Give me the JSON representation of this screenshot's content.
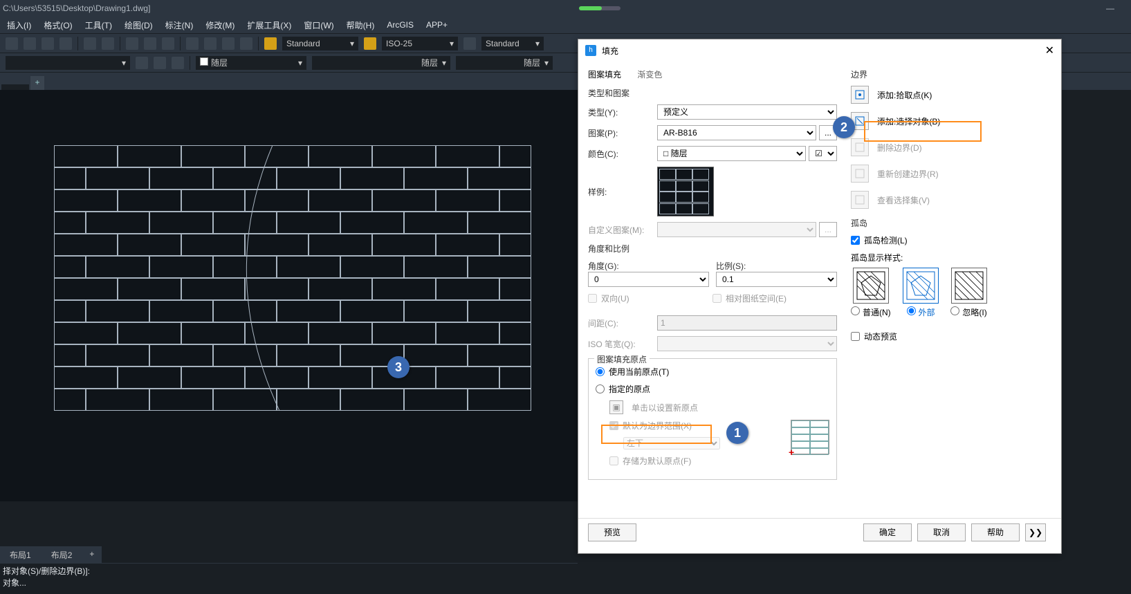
{
  "window": {
    "title": " C:\\Users\\53515\\Desktop\\Drawing1.dwg]"
  },
  "menu": {
    "insert": "插入(I)",
    "format": "格式(O)",
    "tools": "工具(T)",
    "draw": "绘图(D)",
    "dim": "标注(N)",
    "modify": "修改(M)",
    "ext": "扩展工具(X)",
    "window": "窗口(W)",
    "help": "帮助(H)",
    "arcgis": "ArcGIS",
    "app": "APP+"
  },
  "style": {
    "text": "Standard",
    "dim": "ISO-25",
    "table": "Standard"
  },
  "layer": {
    "bylayer": "随层",
    "bylayer2": "随层",
    "bylayer3": "随层"
  },
  "layouts": {
    "l1": "布局1",
    "l2": "布局2",
    "add": "+"
  },
  "cmd": {
    "line1": "择对象(S)/删除边界(B)]:",
    "line2": "对象..."
  },
  "dlg": {
    "title": "填充",
    "tab_pattern": "图案填充",
    "tab_gradient": "渐变色",
    "sec_type": "类型和图案",
    "type_lbl": "类型(Y):",
    "type_val": "预定义",
    "pattern_lbl": "图案(P):",
    "pattern_val": "AR-B816",
    "color_lbl": "颜色(C):",
    "color_val": "随层",
    "sample_lbl": "样例:",
    "custom_lbl": "自定义图案(M):",
    "sec_angle": "角度和比例",
    "angle_lbl": "角度(G):",
    "angle_val": "0",
    "scale_lbl": "比例(S):",
    "scale_val": "0.1",
    "double_lbl": "双向(U)",
    "paper_lbl": "相对图纸空间(E)",
    "spacing_lbl": "间距(C):",
    "spacing_val": "1",
    "isopen_lbl": "ISO 笔宽(Q):",
    "sec_origin": "图案填充原点",
    "origin_cur": "使用当前原点(T)",
    "origin_spec": "指定的原点",
    "origin_click": "单击以设置新原点",
    "origin_default": "默认为边界范围(X)",
    "origin_pos": "左下",
    "origin_store": "存储为默认原点(F)",
    "sec_boundary": "边界",
    "add_pick": "添加:拾取点(K)",
    "add_sel": "添加:选择对象(B)",
    "del_bound": "删除边界(D)",
    "recreate": "重新创建边界(R)",
    "view_sel": "查看选择集(V)",
    "sec_island": "孤岛",
    "island_detect": "孤岛检测(L)",
    "island_style": "孤岛显示样式:",
    "island_normal": "普通(N)",
    "island_outer": "外部",
    "island_ignore": "忽略(I)",
    "dyn_preview": "动态预览",
    "btn_preview": "预览",
    "btn_ok": "确定",
    "btn_cancel": "取消",
    "btn_help": "帮助"
  }
}
